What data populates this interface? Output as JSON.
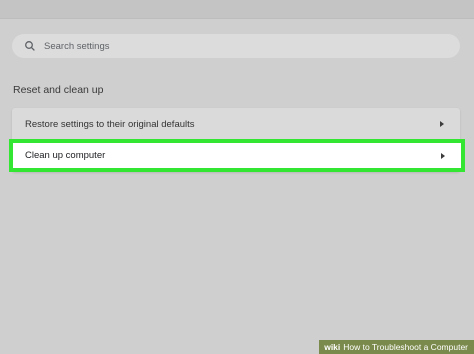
{
  "search": {
    "placeholder": "Search settings",
    "icon": "search-icon"
  },
  "section": {
    "title": "Reset and clean up",
    "items": [
      {
        "label": "Restore settings to their original defaults",
        "icon": "chevron-right-icon"
      },
      {
        "label": "Clean up computer",
        "icon": "chevron-right-icon",
        "highlighted": true
      }
    ]
  },
  "highlight_color": "#32e632",
  "watermark": {
    "logo": "wiki",
    "text": "How to Troubleshoot a Computer"
  }
}
